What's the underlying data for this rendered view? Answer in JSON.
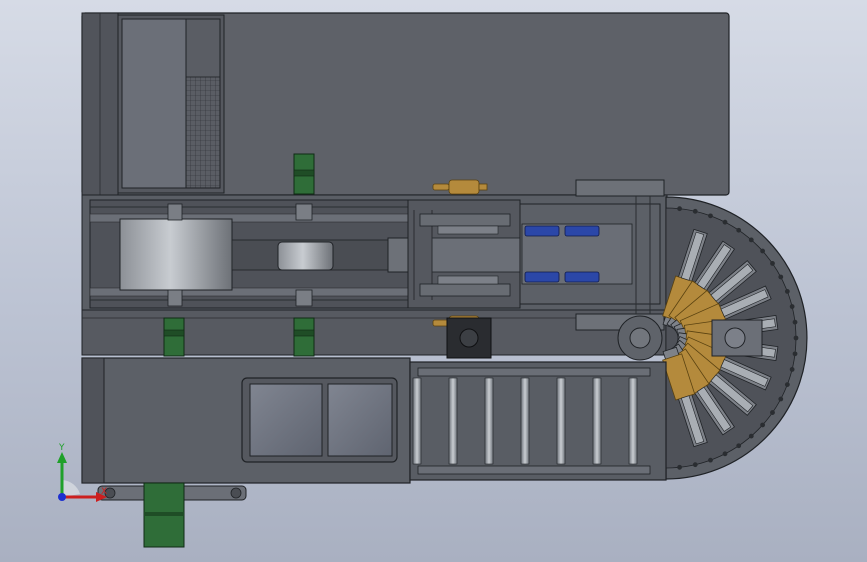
{
  "viewport": {
    "background_top": "#d6dbe6",
    "background_bottom": "#a9b0c1"
  },
  "colors": {
    "frame": "#5b5f66",
    "frame_light": "#6e737b",
    "frame_dark": "#3a3d42",
    "edge": "#1f2226",
    "motor_green": "#2f6d38",
    "brass": "#b48a3c",
    "cylinder_blue": "#2b47a8",
    "roller": "#8e949b"
  },
  "triad": {
    "x_label": "X",
    "y_label": "Y",
    "x_color": "#cc1f1f",
    "y_color": "#1fa02a",
    "z_color": "#1c2fd0"
  },
  "components": {
    "rotary_table_slots": 10,
    "conveyor_rollers": 7
  }
}
